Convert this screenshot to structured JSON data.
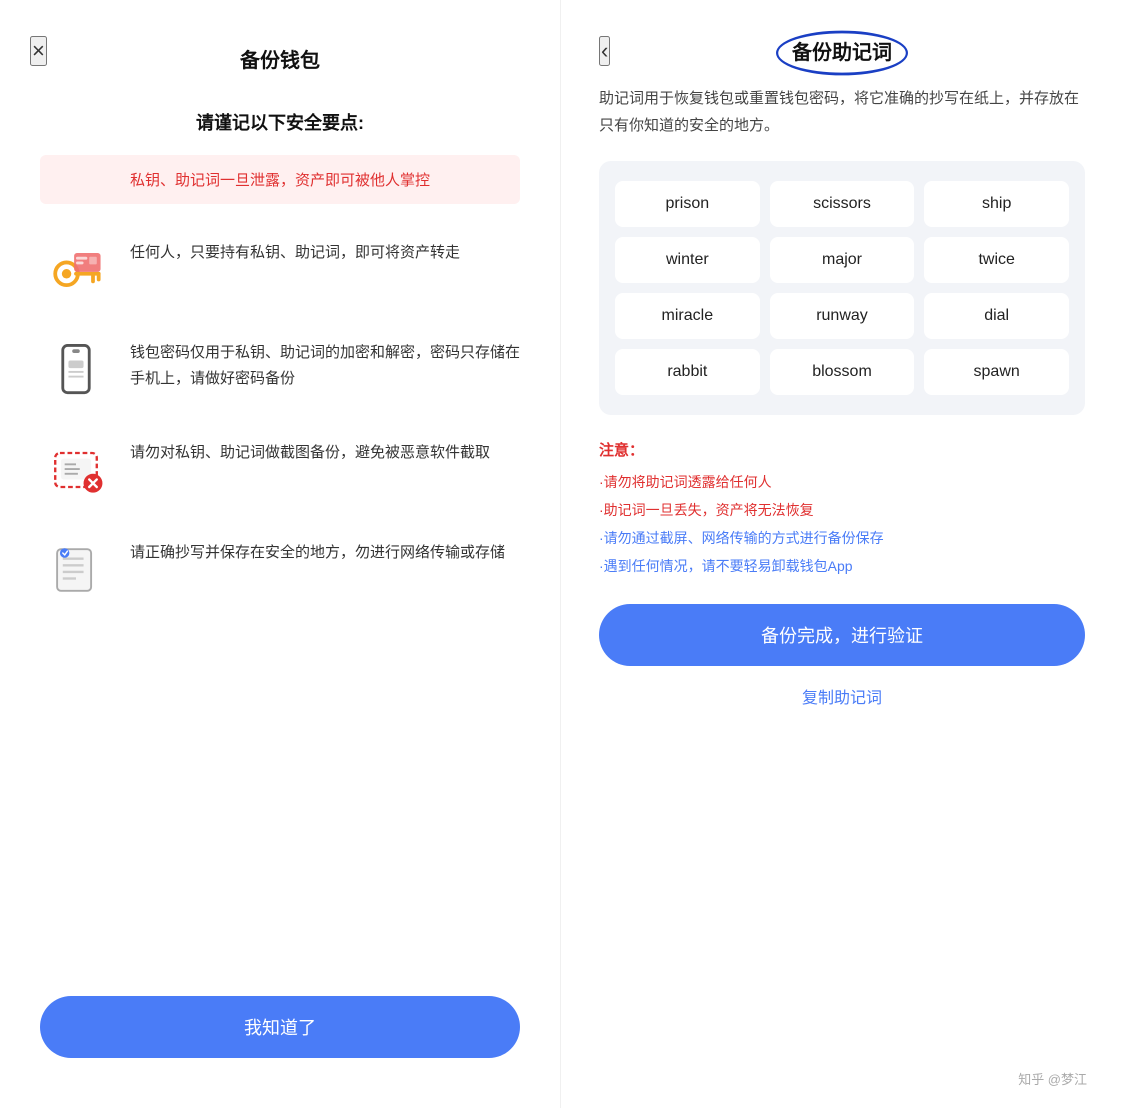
{
  "left": {
    "close_icon": "×",
    "title": "备份钱包",
    "subtitle": "请谨记以下安全要点:",
    "warning": "私钥、助记词一旦泄露，资产即可被他人掌控",
    "tips": [
      {
        "id": "tip1",
        "text": "任何人，只要持有私钥、助记词，即可将资产转走"
      },
      {
        "id": "tip2",
        "text": "钱包密码仅用于私钥、助记词的加密和解密，密码只存储在手机上，请做好密码备份"
      },
      {
        "id": "tip3",
        "text": "请勿对私钥、助记词做截图备份，避免被恶意软件截取"
      },
      {
        "id": "tip4",
        "text": "请正确抄写并保存在安全的地方，勿进行网络传输或存储"
      }
    ],
    "confirm_button": "我知道了"
  },
  "right": {
    "back_icon": "‹",
    "title": "备份助记词",
    "description": "助记词用于恢复钱包或重置钱包密码，将它准确的抄写在纸上，并存放在只有你知道的安全的地方。",
    "mnemonic_words": [
      "prison",
      "scissors",
      "ship",
      "winter",
      "major",
      "twice",
      "miracle",
      "runway",
      "dial",
      "rabbit",
      "blossom",
      "spawn"
    ],
    "notes_title": "注意：",
    "notes": [
      {
        "text": "·请勿将助记词透露给任何人",
        "color": "red"
      },
      {
        "text": "·助记词一旦丢失，资产将无法恢复",
        "color": "red"
      },
      {
        "text": "·请勿通过截屏、网络传输的方式进行备份保存",
        "color": "blue"
      },
      {
        "text": "·遇到任何情况，请不要轻易卸载钱包App",
        "color": "blue"
      }
    ],
    "verify_button": "备份完成，进行验证",
    "copy_link": "复制助记词",
    "watermark": "知乎 @梦江"
  }
}
